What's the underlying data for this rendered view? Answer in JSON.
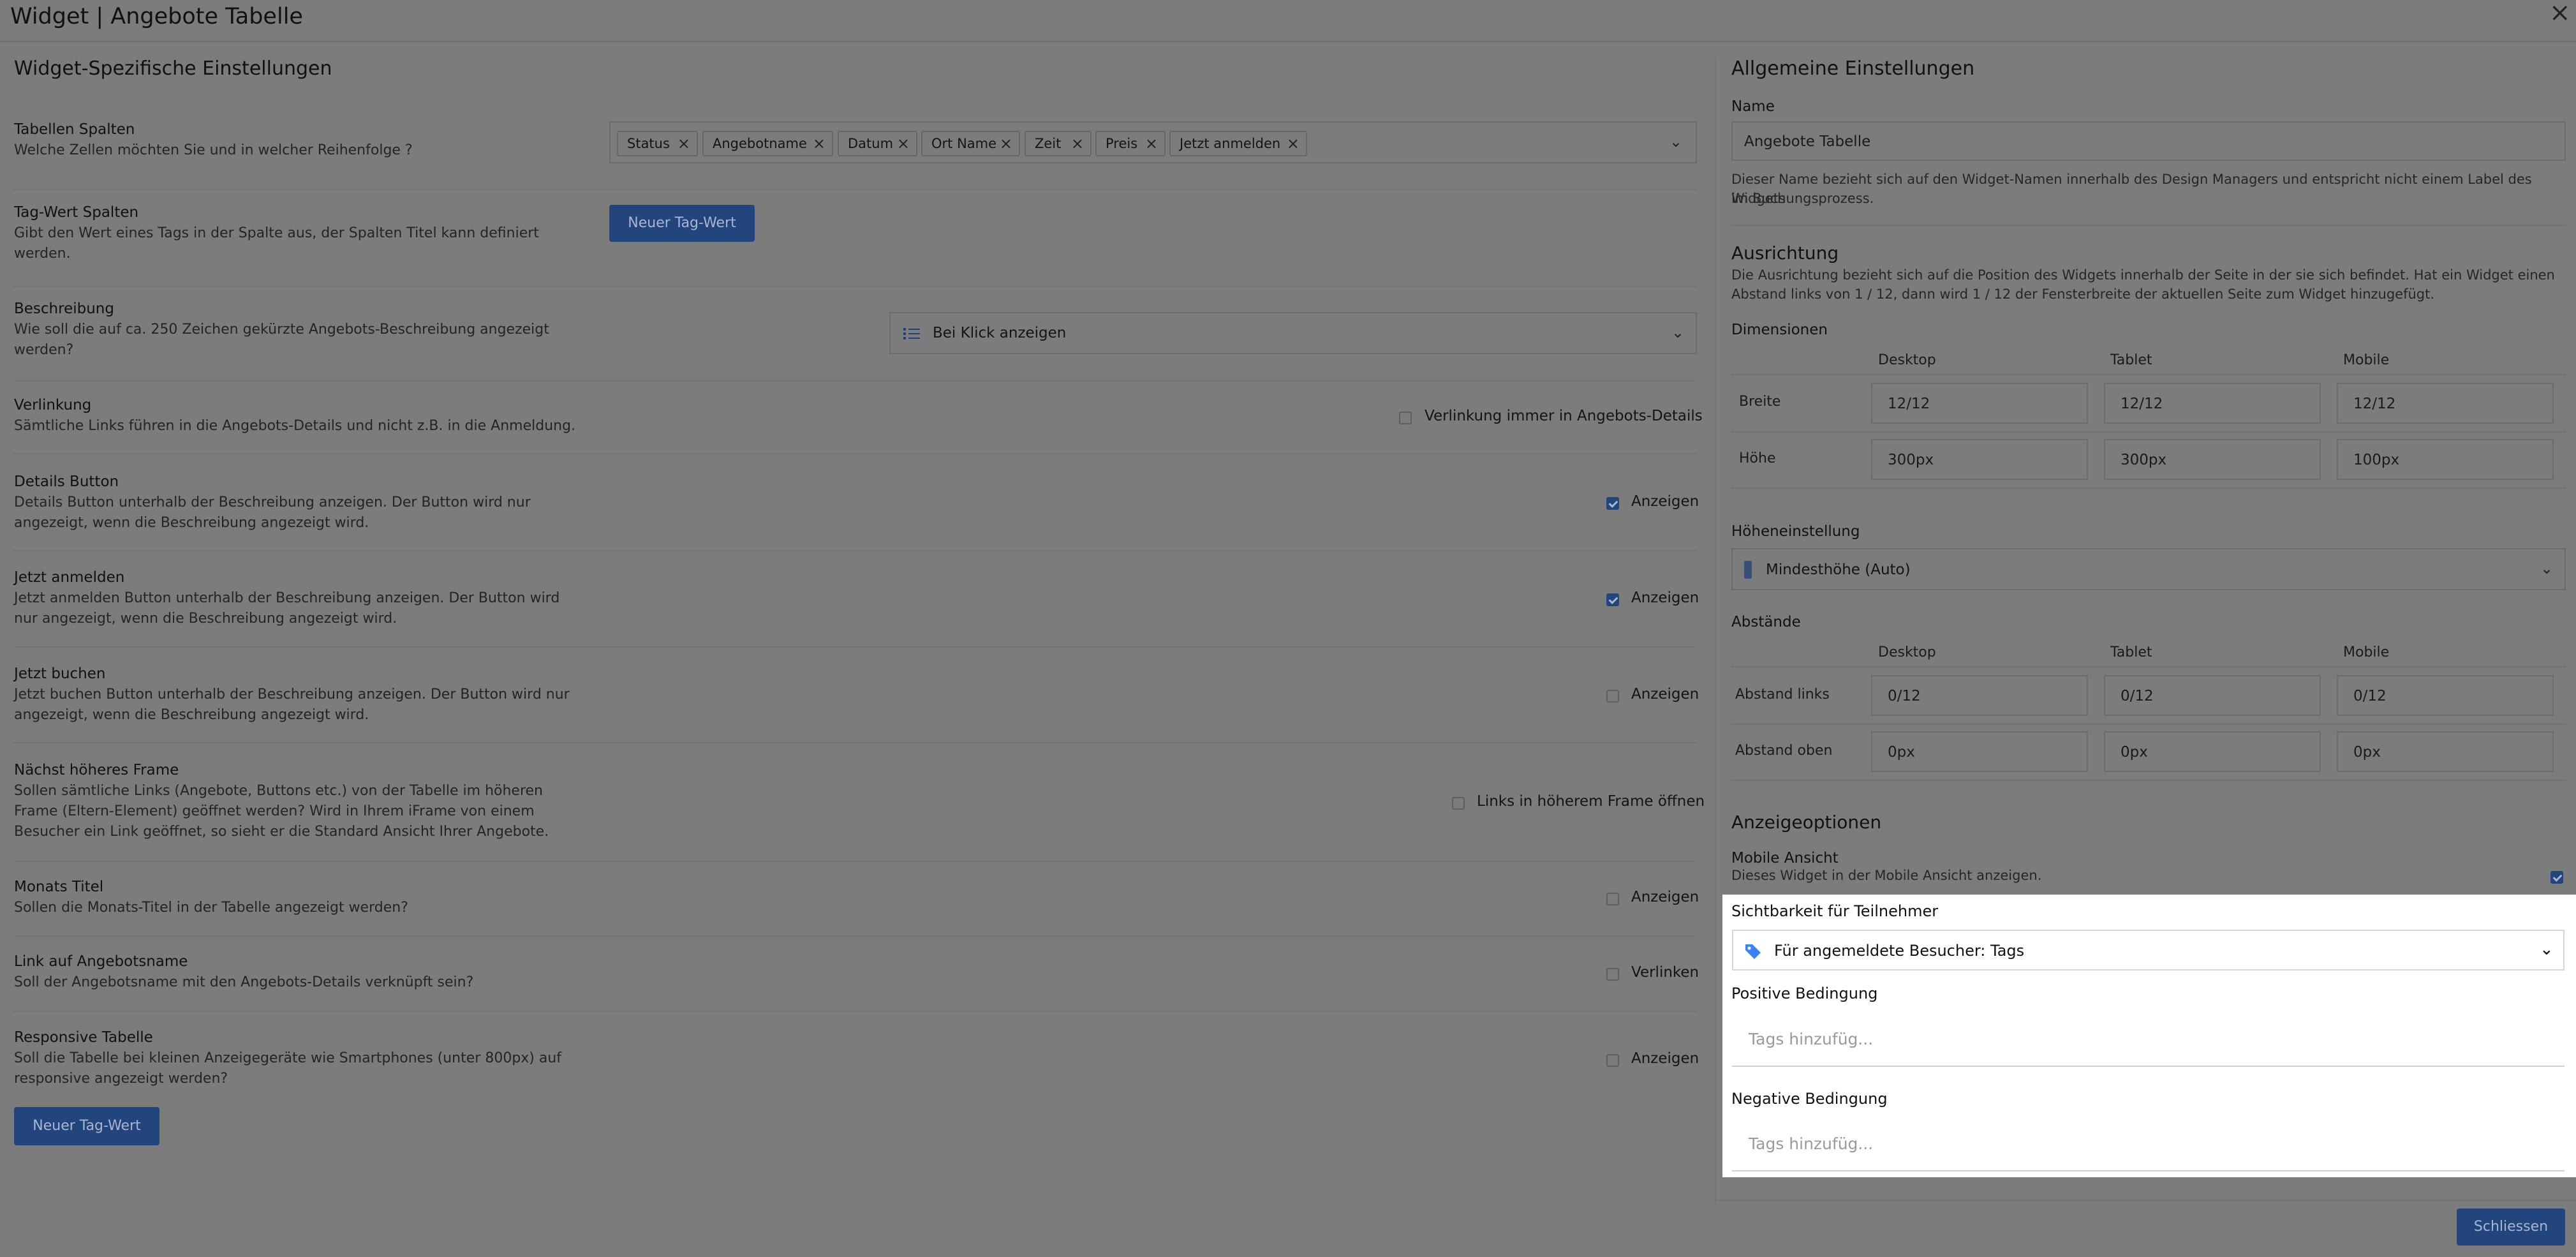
{
  "window": {
    "title": "Widget | Angebote Tabelle",
    "close_glyph": "×"
  },
  "left": {
    "section_title": "Widget-Spezifische Einstellungen",
    "table_columns": {
      "label": "Tabellen Spalten",
      "desc": "Welche Zellen möchten Sie und in welcher Reihenfolge ?",
      "chips": [
        "Status",
        "Angebotname",
        "Datum",
        "Ort Name",
        "Zeit",
        "Preis",
        "Jetzt anmelden"
      ]
    },
    "tag_columns": {
      "label": "Tag-Wert Spalten",
      "desc1": "Gibt den Wert eines Tags in der Spalte aus, der Spalten Titel kann definiert",
      "desc2": "werden.",
      "button": "Neuer Tag-Wert"
    },
    "description": {
      "label": "Beschreibung",
      "desc1": "Wie soll die auf ca. 250 Zeichen gekürzte Angebots-Beschreibung angezeigt",
      "desc2": "werden?",
      "select_value": "Bei Klick anzeigen"
    },
    "linking": {
      "label": "Verlinkung",
      "desc": "Sämtliche Links führen in die Angebots-Details und nicht z.B. in die Anmeldung.",
      "checkbox_label": "Verlinkung immer in Angebots-Details",
      "checked": false
    },
    "details_button": {
      "label": "Details Button",
      "desc1": "Details Button unterhalb der Beschreibung anzeigen. Der Button wird nur",
      "desc2": "angezeigt, wenn die Beschreibung angezeigt wird.",
      "checkbox_label": "Anzeigen",
      "checked": true
    },
    "register_now": {
      "label": "Jetzt anmelden",
      "desc1": "Jetzt anmelden Button unterhalb der Beschreibung anzeigen. Der Button wird",
      "desc2": "nur angezeigt, wenn die Beschreibung angezeigt wird.",
      "checkbox_label": "Anzeigen",
      "checked": true
    },
    "book_now": {
      "label": "Jetzt buchen",
      "desc1": "Jetzt buchen Button unterhalb der Beschreibung anzeigen. Der Button wird nur",
      "desc2": "angezeigt, wenn die Beschreibung angezeigt wird.",
      "checkbox_label": "Anzeigen",
      "checked": false
    },
    "next_frame": {
      "label": "Nächst höheres Frame",
      "desc1": "Sollen sämtliche Links (Angebote, Buttons etc.) von der Tabelle im höheren",
      "desc2": "Frame (Eltern-Element) geöffnet werden? Wird in Ihrem iFrame von einem",
      "desc3": "Besucher ein Link geöffnet, so sieht er die Standard Ansicht Ihrer Angebote.",
      "checkbox_label": "Links in höherem Frame öffnen",
      "checked": false
    },
    "month_title": {
      "label": "Monats Titel",
      "desc": "Sollen die Monats-Titel in der Tabelle angezeigt werden?",
      "checkbox_label": "Anzeigen",
      "checked": false
    },
    "offer_link": {
      "label": "Link auf Angebotsname",
      "desc": "Soll der Angebotsname mit den Angebots-Details verknüpft sein?",
      "checkbox_label": "Verlinken",
      "checked": false
    },
    "responsive": {
      "label": "Responsive Tabelle",
      "desc1": "Soll die Tabelle bei kleinen Anzeigegeräte wie Smartphones (unter 800px) auf",
      "desc2": "responsive angezeigt werden?",
      "checkbox_label": "Anzeigen",
      "checked": false
    },
    "bottom_button": "Neuer Tag-Wert"
  },
  "right": {
    "section_title": "Allgemeine Einstellungen",
    "name_label": "Name",
    "name_value": "Angebote Tabelle",
    "name_help1": "Dieser Name bezieht sich auf den Widget-Namen innerhalb des Design Managers und entspricht nicht einem Label des Widgets",
    "name_help2": "im Buchungsprozess.",
    "alignment_title": "Ausrichtung",
    "alignment_help1": "Die Ausrichtung bezieht sich auf die Position des Widgets innerhalb der Seite in der sie sich befindet. Hat ein Widget einen",
    "alignment_help2": "Abstand links von 1 / 12, dann wird 1 / 12 der Fensterbreite der aktuellen Seite zum Widget hinzugefügt.",
    "dimensions_label": "Dimensionen",
    "dims_headers": [
      "Desktop",
      "Tablet",
      "Mobile"
    ],
    "width_label": "Breite",
    "width_values": [
      "12/12",
      "12/12",
      "12/12"
    ],
    "height_label": "Höhe",
    "height_values": [
      "300px",
      "300px",
      "100px"
    ],
    "height_setting_label": "Höheneinstellung",
    "height_setting_value": "Mindesthöhe (Auto)",
    "spacing_label": "Abstände",
    "spacing_headers": [
      "Desktop",
      "Tablet",
      "Mobile"
    ],
    "left_spacing_label": "Abstand links",
    "left_spacing_values": [
      "0/12",
      "0/12",
      "0/12"
    ],
    "top_spacing_label": "Abstand oben",
    "top_spacing_values": [
      "0px",
      "0px",
      "0px"
    ],
    "display_options_title": "Anzeigeoptionen",
    "mobile_view_label": "Mobile Ansicht",
    "mobile_view_help": "Dieses Widget in der Mobile Ansicht anzeigen.",
    "mobile_view_checked": true,
    "visibility_label": "Sichtbarkeit für Teilnehmer",
    "visibility_value": "Für angemeldete Besucher: Tags",
    "positive_label": "Positive Bedingung",
    "positive_placeholder": "Tags hinzufüg...",
    "negative_label": "Negative Bedingung",
    "negative_placeholder": "Tags hinzufüg...",
    "close_button": "Schliessen"
  },
  "colors": {
    "accent": "#2563eb",
    "tag_icon": "#3b82f6",
    "overlay": "#7c7c7c"
  },
  "icons": [
    "close-icon",
    "chevron-down-icon",
    "list-icon",
    "height-icon",
    "tag-icon",
    "check-icon"
  ]
}
